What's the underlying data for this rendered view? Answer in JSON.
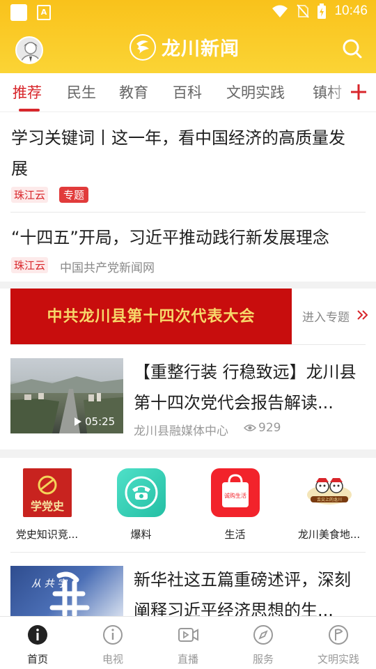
{
  "status_bar": {
    "time": "10:46"
  },
  "header": {
    "app_title": "龙川新闻"
  },
  "tabs": [
    {
      "label": "推荐",
      "active": true
    },
    {
      "label": "民生"
    },
    {
      "label": "教育"
    },
    {
      "label": "百科"
    },
    {
      "label": "文明实践"
    },
    {
      "label": "镇村"
    }
  ],
  "articles": [
    {
      "title": "学习关键词丨这一年，看中国经济的高质量发展",
      "source": "珠江云",
      "tag": "专题"
    },
    {
      "title": "“十四五”开局，习近平推动践行新发展理念",
      "source": "珠江云",
      "publisher": "中国共产党新闻网"
    }
  ],
  "banner": {
    "text": "中共龙川县第十四次代表大会",
    "link_label": "进入专题"
  },
  "video_article": {
    "title": "【重整行装 行稳致远】龙川县第十四次党代会报告解读...",
    "duration": "05:25",
    "publisher": "龙川县融媒体中心",
    "views": "929"
  },
  "services": [
    {
      "label": "党史知识竞...",
      "icon_text": "学党史"
    },
    {
      "label": "爆料"
    },
    {
      "label": "生活",
      "icon_text": "诚购生活"
    },
    {
      "label": "龙川美食地...",
      "icon_text": "舌尖上的龙川"
    }
  ],
  "bottom_article": {
    "title": "新华社这五篇重磅述评，深刻阐释习近平经济思想的生...",
    "thumb_text": "从 共 字"
  },
  "bottom_nav": [
    {
      "label": "首页",
      "active": true
    },
    {
      "label": "电视"
    },
    {
      "label": "直播"
    },
    {
      "label": "服务"
    },
    {
      "label": "文明实践"
    }
  ],
  "colors": {
    "header_yellow": "#f9c21b",
    "accent_red": "#d8262b"
  }
}
